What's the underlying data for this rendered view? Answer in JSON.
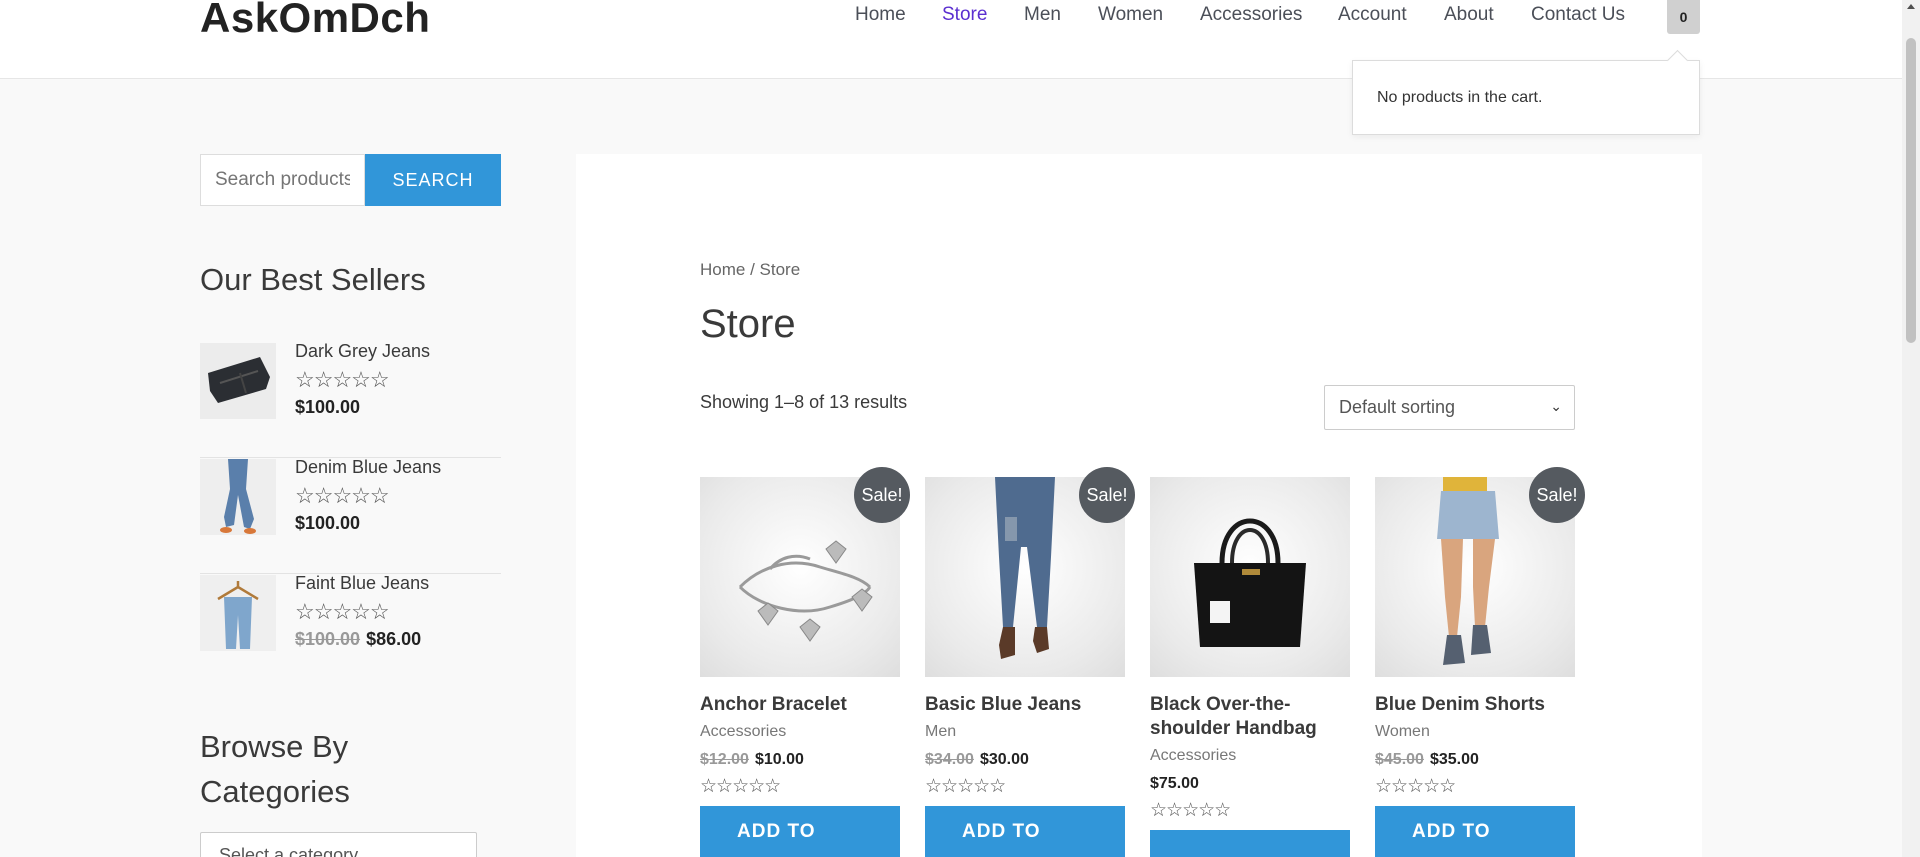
{
  "header": {
    "logo": "AskOmDch",
    "nav": [
      {
        "label": "Home",
        "active": false
      },
      {
        "label": "Store",
        "active": true
      },
      {
        "label": "Men",
        "active": false
      },
      {
        "label": "Women",
        "active": false
      },
      {
        "label": "Accessories",
        "active": false
      },
      {
        "label": "Account",
        "active": false
      },
      {
        "label": "About",
        "active": false
      },
      {
        "label": "Contact Us",
        "active": false
      }
    ],
    "cart_count": "0",
    "cart_message": "No products in the cart."
  },
  "sidebar": {
    "search_placeholder": "Search products…",
    "search_button": "SEARCH",
    "best_sellers_title": "Our Best Sellers",
    "best_sellers": [
      {
        "name": "Dark Grey Jeans",
        "rating": "☆☆☆☆☆",
        "old_price": "",
        "price": "$100.00"
      },
      {
        "name": "Denim Blue Jeans",
        "rating": "☆☆☆☆☆",
        "old_price": "",
        "price": "$100.00"
      },
      {
        "name": "Faint Blue Jeans",
        "rating": "☆☆☆☆☆",
        "old_price": "$100.00",
        "price": "$86.00"
      }
    ],
    "categories_title_line1": "Browse By",
    "categories_title_line2": "Categories",
    "category_select": "Select a category"
  },
  "main": {
    "breadcrumb": "Home / Store",
    "title": "Store",
    "result_count": "Showing 1–8 of 13 results",
    "sort_selected": "Default sorting",
    "products": [
      {
        "name": "Anchor Bracelet",
        "category": "Accessories",
        "old_price": "$12.00",
        "price": "$10.00",
        "sale": "Sale!",
        "rating": "☆☆☆☆☆",
        "button": "ADD TO"
      },
      {
        "name": "Basic Blue Jeans",
        "category": "Men",
        "old_price": "$34.00",
        "price": "$30.00",
        "sale": "Sale!",
        "rating": "☆☆☆☆☆",
        "button": "ADD TO"
      },
      {
        "name": "Black Over-the-shoulder Handbag",
        "category": "Accessories",
        "old_price": "",
        "price": "$75.00",
        "sale": "",
        "rating": "☆☆☆☆☆",
        "button": ""
      },
      {
        "name": "Blue Denim Shorts",
        "category": "Women",
        "old_price": "$45.00",
        "price": "$35.00",
        "sale": "Sale!",
        "rating": "☆☆☆☆☆",
        "button": "ADD TO"
      }
    ]
  },
  "colors": {
    "accent": "#3196d9",
    "nav_active": "#5b2fd0",
    "sale_badge": "#555a60"
  }
}
